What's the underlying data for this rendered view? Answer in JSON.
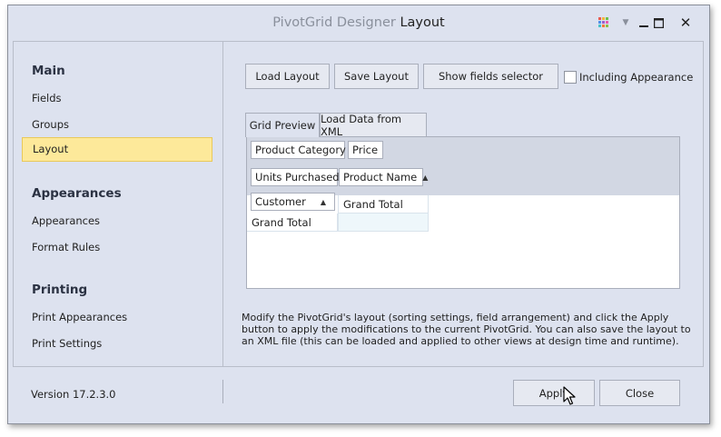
{
  "window": {
    "title_prefix": "PivotGrid Designer",
    "title_main": "Layout",
    "controls": {
      "skin": "color-grid-icon",
      "dropdown": "▼",
      "minimize": "minimize-icon",
      "maximize": "□",
      "close": "✕"
    }
  },
  "sidebar": {
    "sections": [
      {
        "title": "Main",
        "items": [
          "Fields",
          "Groups",
          "Layout"
        ]
      },
      {
        "title": "Appearances",
        "items": [
          "Appearances",
          "Format Rules"
        ]
      },
      {
        "title": "Printing",
        "items": [
          "Print Appearances",
          "Print Settings"
        ]
      }
    ],
    "selected": "Layout"
  },
  "toolbar": {
    "load_layout": "Load Layout",
    "save_layout": "Save Layout",
    "show_fields": "Show fields selector",
    "including_appearance": "Including Appearance",
    "including_appearance_checked": false
  },
  "tabs": [
    "Grid Preview",
    "Load Data from XML"
  ],
  "active_tab": "Grid Preview",
  "pivot": {
    "filter_fields": [
      "Product Category",
      "Price"
    ],
    "data_field": "Units Purchased",
    "column_field": "Product Name",
    "row_field": "Customer",
    "column_grand_total": "Grand Total",
    "row_grand_total": "Grand Total"
  },
  "description": "Modify the PivotGrid's layout (sorting settings, field arrangement) and click the Apply button to apply the modifications to the current PivotGrid. You can also save the layout to an XML file (this can be loaded and applied to other views at design time and runtime).",
  "footer": {
    "version": "Version 17.2.3.0",
    "apply": "Apply",
    "close": "Close"
  },
  "colors": {
    "window_bg": "#dde2ef",
    "selected_bg": "#fde99a",
    "header_area": "#d2d7e3"
  }
}
